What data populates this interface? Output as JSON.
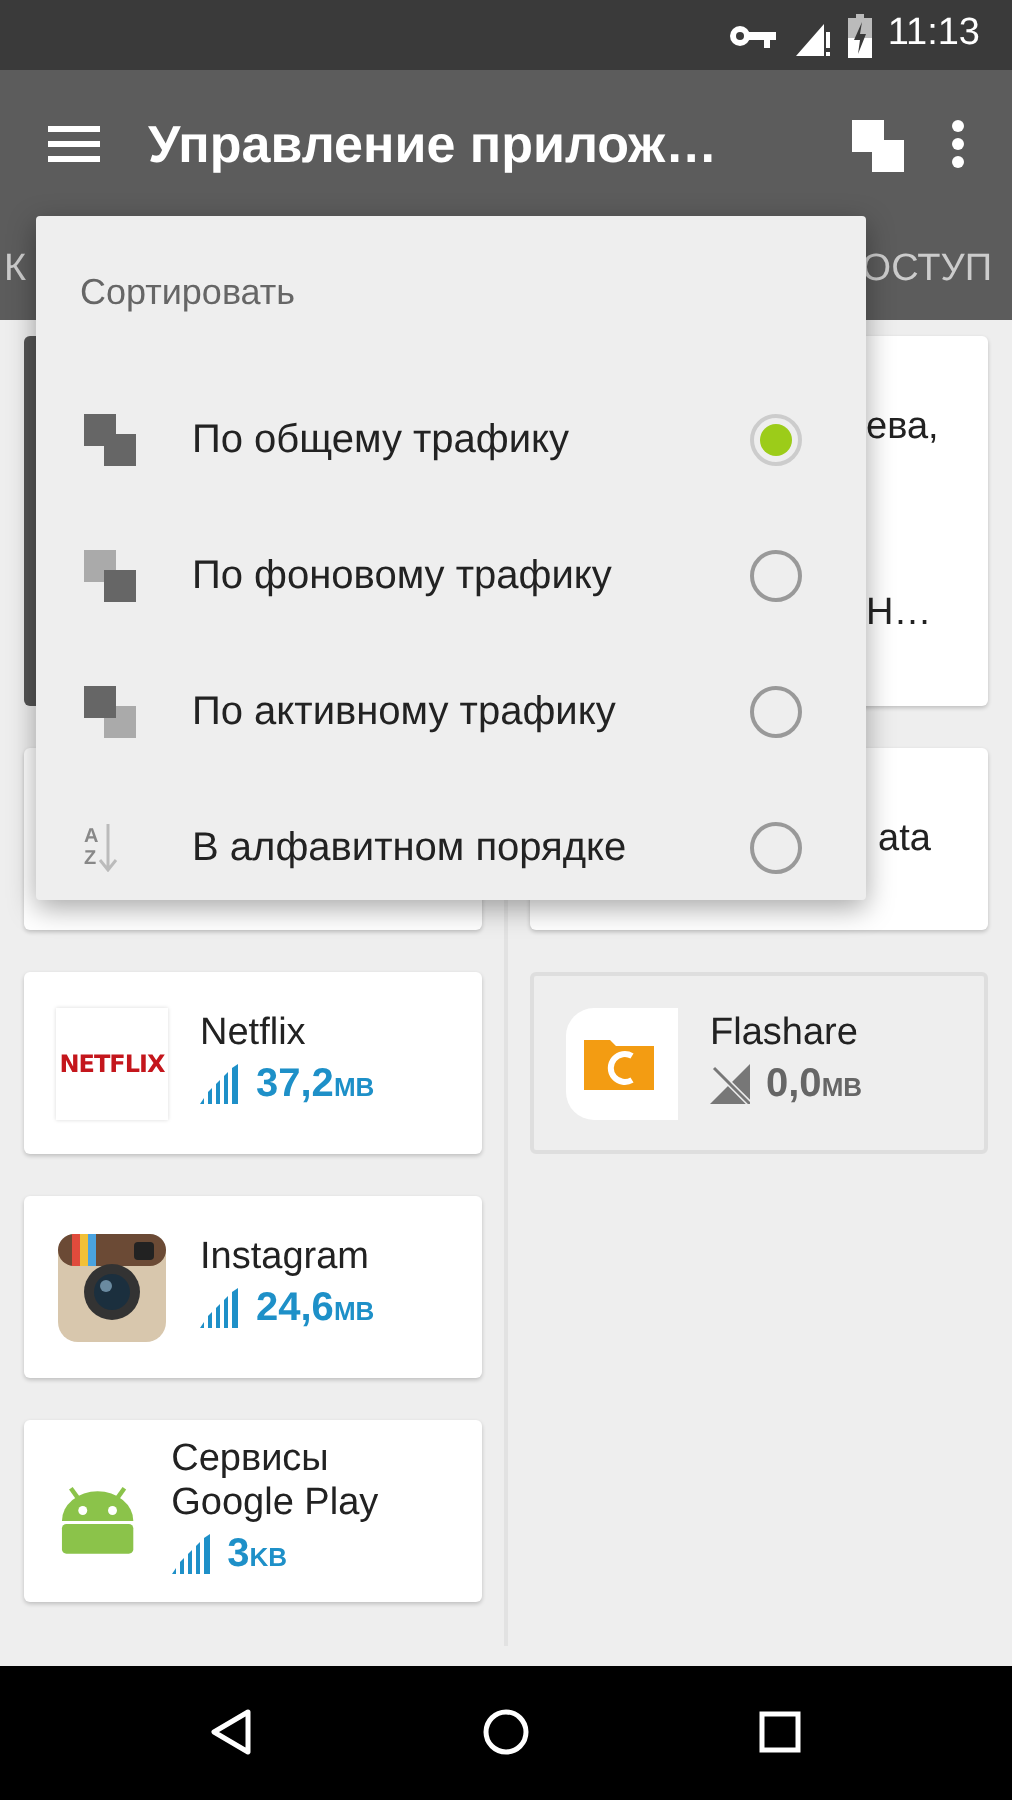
{
  "status_bar": {
    "time": "11:13"
  },
  "toolbar": {
    "title": "Управление прилож…"
  },
  "tabs": [
    {
      "label": "К"
    },
    {
      "label": "ОСТУП"
    }
  ],
  "sort_menu": {
    "title": "Сортировать",
    "options": [
      {
        "label": "По общему трафику",
        "selected": true,
        "kind": "total"
      },
      {
        "label": "По фоновому трафику",
        "selected": false,
        "kind": "background"
      },
      {
        "label": "По активному трафику",
        "selected": false,
        "kind": "foreground"
      },
      {
        "label": "В алфавитном порядке",
        "selected": false,
        "kind": "alpha",
        "icon_letters": [
          "A",
          "Z"
        ]
      }
    ]
  },
  "left_column": [
    {
      "kind": "dark"
    },
    {
      "kind": "app"
    },
    {
      "kind": "app",
      "logo_text": "NETFLIX",
      "name": "Netflix",
      "amount": "37,2",
      "unit": "MB",
      "active": true
    },
    {
      "kind": "app",
      "name": "Instagram",
      "amount": "24,6",
      "unit": "MB",
      "active": true
    },
    {
      "kind": "app",
      "name": "Сервисы Google Play",
      "amount": "3",
      "unit": "KB",
      "active": true
    }
  ],
  "right_column": [
    {
      "kind": "fragment",
      "lines": [
        "ева,",
        "Н…"
      ]
    },
    {
      "kind": "covered_app",
      "name": "ata"
    },
    {
      "kind": "app",
      "name": "Flashare",
      "amount": "0,0",
      "unit": "MB",
      "active": false
    }
  ]
}
